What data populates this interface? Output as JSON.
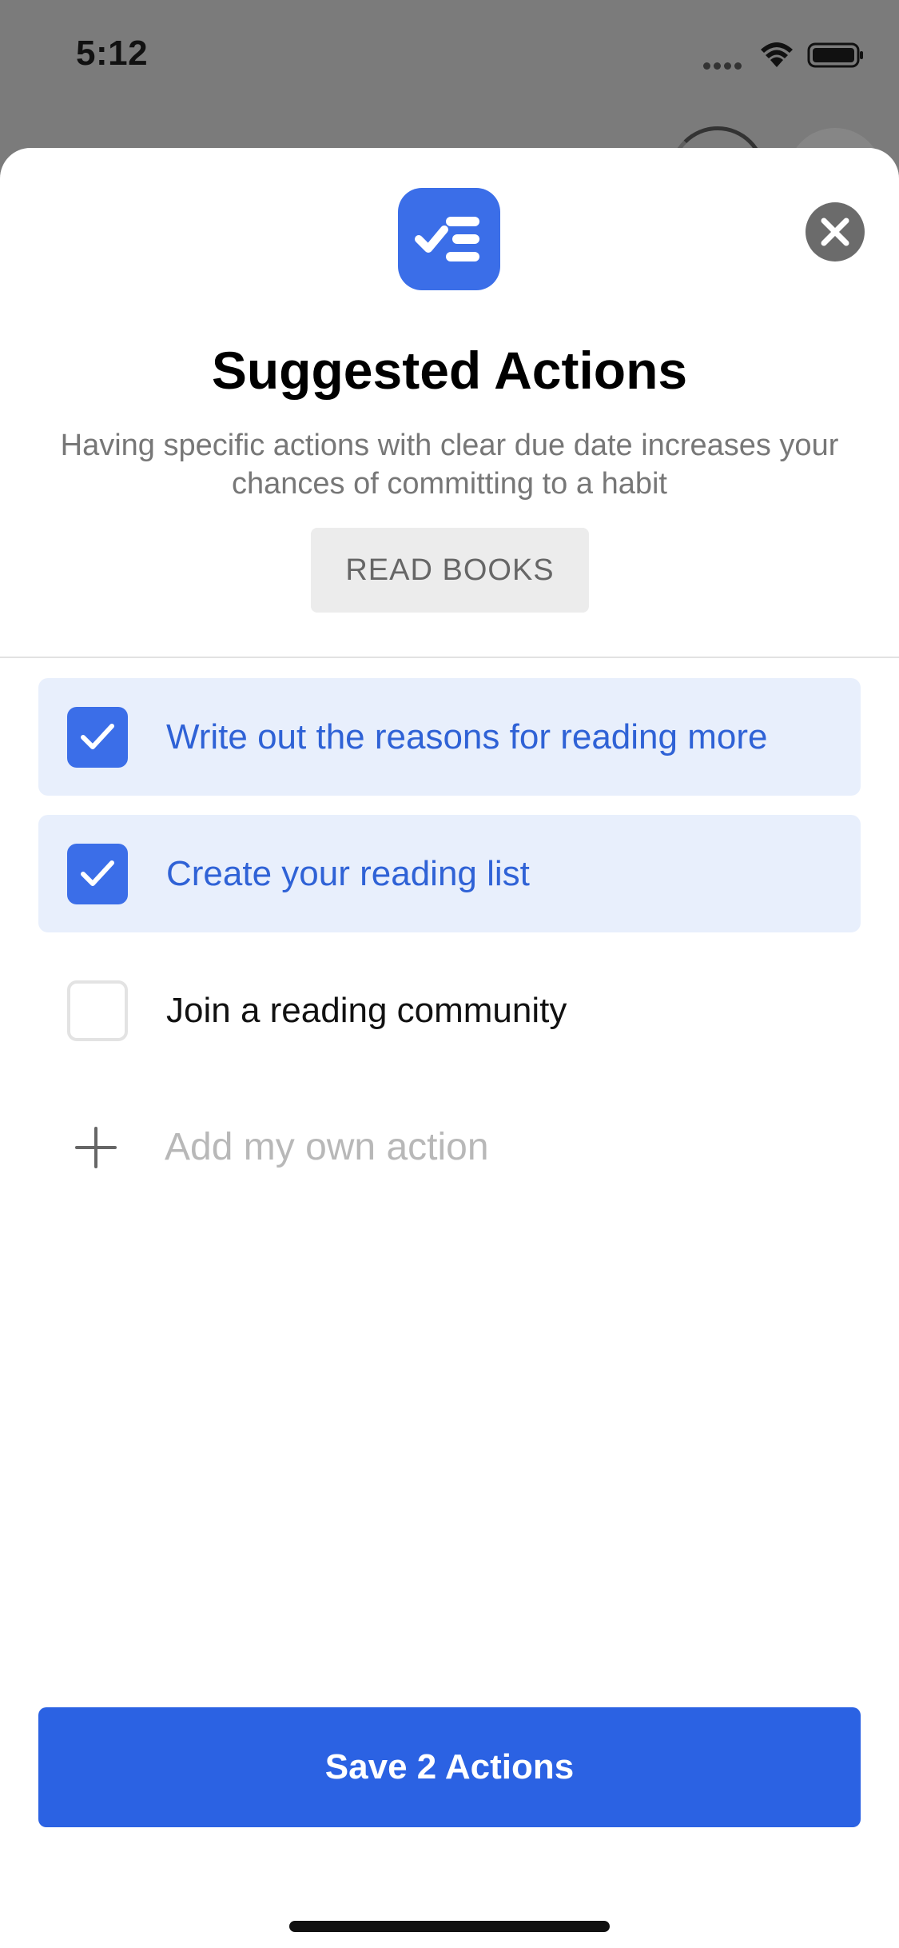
{
  "status_bar": {
    "time": "5:12"
  },
  "sheet": {
    "icon": "checklist-icon",
    "title": "Suggested Actions",
    "subtitle": "Having specific actions with clear due date increases your chances of committing to a habit",
    "habit_chip": "READ BOOKS",
    "close_icon": "close-icon"
  },
  "actions": [
    {
      "label": "Write out the reasons for reading more",
      "checked": true
    },
    {
      "label": "Create your reading list",
      "checked": true
    },
    {
      "label": "Join a reading community",
      "checked": false
    }
  ],
  "add_action": {
    "icon": "plus-icon",
    "placeholder": "Add my own action"
  },
  "save_button": {
    "label": "Save 2 Actions"
  },
  "colors": {
    "accent": "#2b62e3",
    "checked_row_bg": "#e8effc",
    "checked_text": "#2f62d6",
    "overlay": "#7b7b7b"
  }
}
